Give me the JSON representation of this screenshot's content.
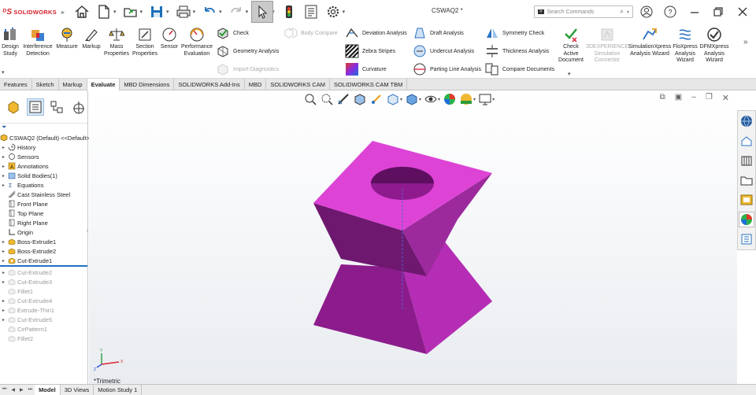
{
  "app": {
    "logo_text": "SOLIDWORKS",
    "doc_title": "CSWAQ2 *",
    "search_placeholder": "Search Commands"
  },
  "ribbon": {
    "tools": [
      {
        "label": "Design Study",
        "icon": "design-study-icon"
      },
      {
        "label": "Interference Detection",
        "icon": "interference-icon"
      },
      {
        "label": "Measure",
        "icon": "measure-icon"
      },
      {
        "label": "Markup",
        "icon": "markup-icon"
      },
      {
        "label": "Mass Properties",
        "icon": "mass-properties-icon"
      },
      {
        "label": "Section Properties",
        "icon": "section-properties-icon"
      },
      {
        "label": "Sensor",
        "icon": "sensor-icon"
      },
      {
        "label": "Performance Evaluation",
        "icon": "performance-icon"
      }
    ],
    "check": "Check",
    "geometry_analysis": "Geometry Analysis",
    "import_diagnostics": "Import Diagnostics",
    "body_compare": "Body Compare",
    "deviation_analysis": "Deviation Analysis",
    "zebra_stripes": "Zebra Stripes",
    "curvature": "Curvature",
    "draft_analysis": "Draft Analysis",
    "undercut_analysis": "Undercut Analysis",
    "parting_line_analysis": "Parting Line Analysis",
    "symmetry_check": "Symmetry Check",
    "thickness_analysis": "Thickness Analysis",
    "compare_documents": "Compare Documents",
    "check_active_document": "Check Active Document",
    "exp_sim_connector": "3DEXPERIENCE Simulation Connector",
    "simxpress": "SimulationXpress Analysis Wizard",
    "floxpress": "FloXpress Analysis Wizard",
    "dfmxpress": "DFMXpress Analysis Wizard"
  },
  "tabs": [
    "Features",
    "Sketch",
    "Markup",
    "Evaluate",
    "MBD Dimensions",
    "SOLIDWORKS Add-Ins",
    "MBD",
    "SOLIDWORKS CAM",
    "SOLIDWORKS CAM TBM"
  ],
  "active_tab": "Evaluate",
  "tree": {
    "root": "CSWAQ2 (Default) <<Default>",
    "items": [
      {
        "label": "History",
        "state": "normal"
      },
      {
        "label": "Sensors",
        "state": "normal"
      },
      {
        "label": "Annotations",
        "state": "normal"
      },
      {
        "label": "Solid Bodies(1)",
        "state": "normal"
      },
      {
        "label": "Equations",
        "state": "normal"
      },
      {
        "label": "Cast Stainless Steel",
        "state": "normal"
      },
      {
        "label": "Front Plane",
        "state": "normal"
      },
      {
        "label": "Top Plane",
        "state": "normal"
      },
      {
        "label": "Right Plane",
        "state": "normal"
      },
      {
        "label": "Origin",
        "state": "normal"
      },
      {
        "label": "Boss-Extrude1",
        "state": "normal"
      },
      {
        "label": "Boss-Extrude2",
        "state": "normal"
      },
      {
        "label": "Cut-Extrude1",
        "state": "normal"
      },
      {
        "label": "Cut-Extrude2",
        "state": "suppressed"
      },
      {
        "label": "Cut-Extrude3",
        "state": "suppressed"
      },
      {
        "label": "Fillet1",
        "state": "suppressed"
      },
      {
        "label": "Cut-Extrude4",
        "state": "suppressed"
      },
      {
        "label": "Extrude-Thin1",
        "state": "suppressed"
      },
      {
        "label": "Cut-Extrude5",
        "state": "suppressed"
      },
      {
        "label": "CirPattern1",
        "state": "suppressed"
      },
      {
        "label": "Fillet2",
        "state": "suppressed"
      }
    ]
  },
  "viewport": {
    "view_label": "*Trimetric",
    "model_color": "#cc33cc",
    "triad": {
      "x": "X",
      "y": "Y",
      "z": "Z"
    }
  },
  "bottom_tabs": [
    "Model",
    "3D Views",
    "Motion Study 1"
  ],
  "active_bottom_tab": "Model"
}
